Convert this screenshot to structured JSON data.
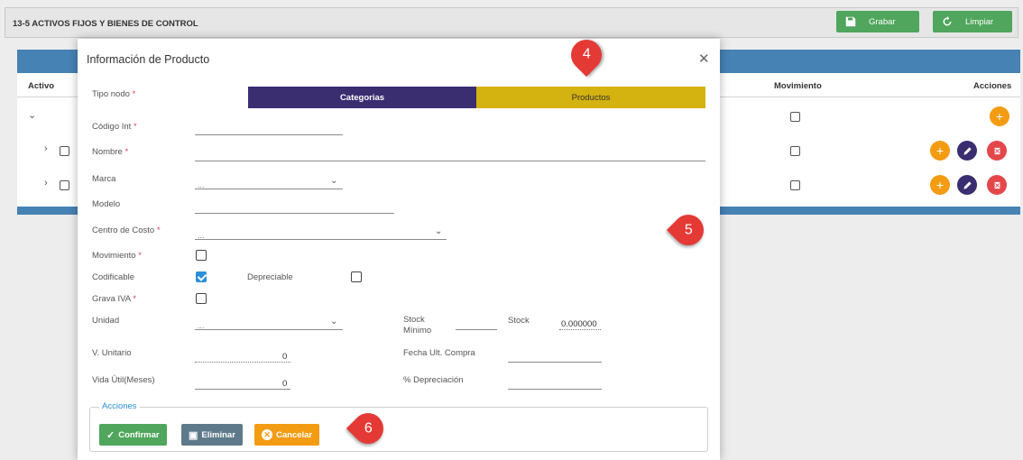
{
  "topbar": {
    "title": "13-5 ACTIVOS FIJOS Y BIENES DE CONTROL",
    "grabar": "Grabar",
    "limpiar": "Limpiar",
    "accent": "#4fa65c"
  },
  "table": {
    "col_activo": "Activo",
    "col_movimiento": "Movimiento",
    "col_acciones": "Acciones",
    "header_color": "#4682b4"
  },
  "modal": {
    "title": "Información de Producto",
    "tipo_nodo": {
      "label": "Tipo nodo",
      "req": "*",
      "opt_categorias": "Categorias",
      "opt_productos": "Productos",
      "selected": "Productos"
    },
    "codigo_int": {
      "label": "Código Int",
      "req": "*"
    },
    "nombre": {
      "label": "Nombre",
      "req": "*"
    },
    "marca": {
      "label": "Marca",
      "value": "..."
    },
    "modelo": {
      "label": "Modelo"
    },
    "centro_costo": {
      "label": "Centro de Costo",
      "req": "*",
      "value": "..."
    },
    "movimiento": {
      "label": "Movimiento",
      "req": "*",
      "checked": false
    },
    "codificable": {
      "label": "Codificable",
      "checked": true
    },
    "depreciable": {
      "label": "Depreciable",
      "checked": false
    },
    "grava_iva": {
      "label": "Grava IVA",
      "req": "*",
      "checked": false
    },
    "unidad": {
      "label": "Unidad",
      "value": "..."
    },
    "stock_minimo": {
      "label_1": "Stock",
      "label_2": "Mínimo"
    },
    "stock": {
      "label": "Stock",
      "value": "0.000000"
    },
    "v_unitario": {
      "label": "V. Unitario",
      "value": "0"
    },
    "fecha_ult_compra": {
      "label": "Fecha Ult. Compra"
    },
    "vida_util": {
      "label": "Vida Útil(Meses)",
      "value": "0"
    },
    "pct_depreciacion": {
      "label": "% Depreciación"
    },
    "acciones": {
      "legend": "Acciones",
      "confirmar": "Confirmar",
      "eliminar": "Eliminar",
      "cancelar": "Cancelar"
    }
  },
  "markers": {
    "m4": "4",
    "m5": "5",
    "m6": "6",
    "color": "#e53935"
  },
  "icons": [
    "save-icon",
    "refresh-icon",
    "close-icon",
    "chevron-down-icon",
    "chevron-right-icon",
    "plus-icon",
    "edit-icon",
    "delete-icon",
    "check-icon",
    "cancel-icon"
  ]
}
